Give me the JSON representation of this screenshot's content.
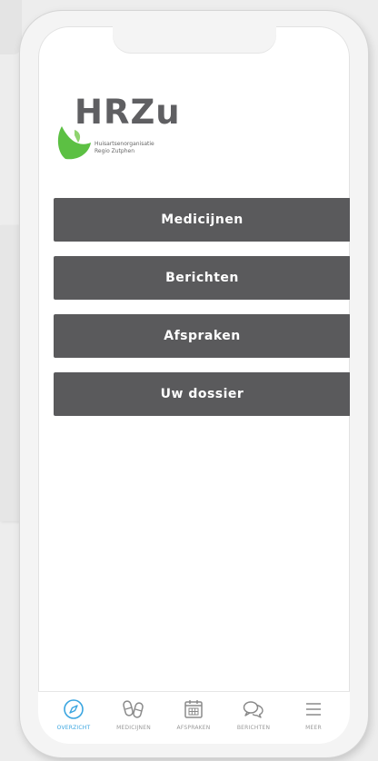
{
  "logo": {
    "text": "HRZu",
    "sub_line1": "Huisartsenorganisatie",
    "sub_line2": "Regio Zutphen"
  },
  "menu": {
    "items": [
      {
        "label": "Medicijnen"
      },
      {
        "label": "Berichten"
      },
      {
        "label": "Afspraken"
      },
      {
        "label": "Uw dossier"
      }
    ]
  },
  "tabbar": {
    "active": "overzicht",
    "items": [
      {
        "label": "OVERZICHT",
        "icon": "compass-icon"
      },
      {
        "label": "MEDICIJNEN",
        "icon": "pills-icon"
      },
      {
        "label": "AFSPRAKEN",
        "icon": "calendar-icon"
      },
      {
        "label": "BERICHTEN",
        "icon": "chat-bubbles-icon"
      },
      {
        "label": "MEER",
        "icon": "hamburger-menu-icon"
      }
    ]
  },
  "colors": {
    "button_bg": "#5a5a5c",
    "accent": "#3aa5e0",
    "logo_green": "#5cc043"
  }
}
